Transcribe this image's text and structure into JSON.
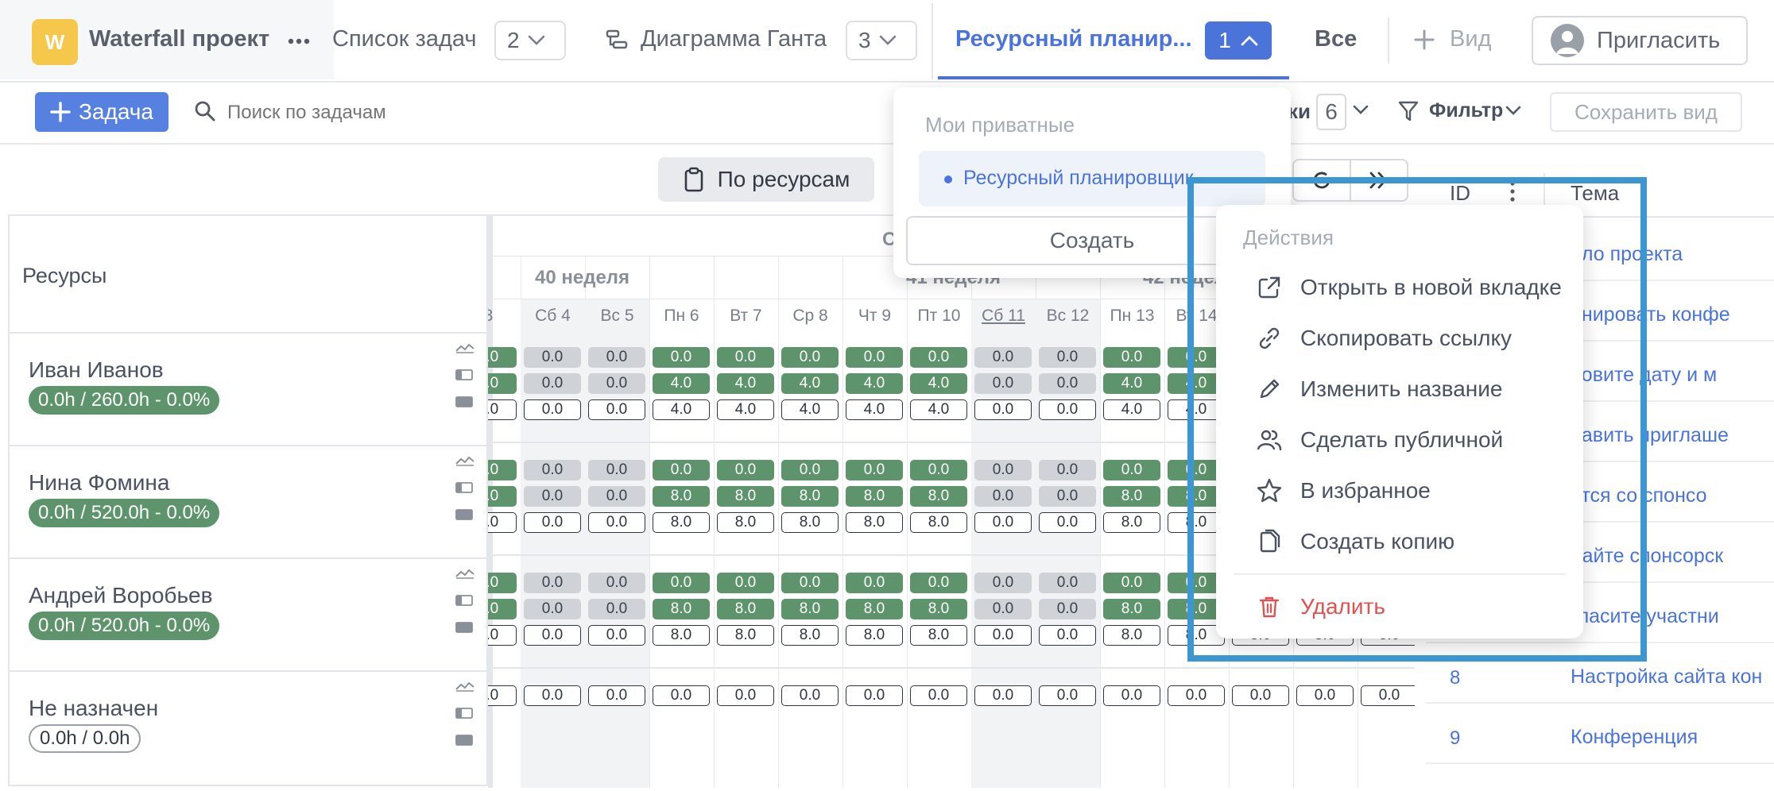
{
  "colors": {
    "accent": "#4a74d9",
    "green": "#5d946b",
    "danger": "#e05252",
    "highlight": "#3b96d2"
  },
  "project": {
    "logo_letter": "W",
    "name": "Waterfall проект"
  },
  "tabs": {
    "task_list": {
      "label": "Список задач",
      "count": "2"
    },
    "gantt": {
      "label": "Диаграмма Ганта",
      "count": "3"
    },
    "resource": {
      "label": "Ресурсный планир...",
      "count": "1"
    },
    "all": {
      "label": "Все"
    },
    "add_view": {
      "label": "Вид"
    },
    "invite": {
      "label": "Пригласить"
    }
  },
  "toolbar": {
    "add_task_label": "Задача",
    "search_placeholder": "Поиск по задачам",
    "columns_label": "ки",
    "columns_count": "6",
    "filter_label": "Фильтр",
    "save_view_label": "Сохранить вид"
  },
  "view": {
    "by_resources_label": "По ресурсам"
  },
  "resources_header": "Ресурсы",
  "weeks": [
    {
      "label": "40 неделя"
    },
    {
      "label": "41 неделя"
    },
    {
      "label": "42 неделя"
    }
  ],
  "month_fragment": "С",
  "days": [
    {
      "label": "3",
      "weekend": false,
      "partial": true
    },
    {
      "label": "Сб 4",
      "weekend": true
    },
    {
      "label": "Вс 5",
      "weekend": true
    },
    {
      "label": "Пн 6",
      "weekend": false
    },
    {
      "label": "Вт 7",
      "weekend": false
    },
    {
      "label": "Ср 8",
      "weekend": false
    },
    {
      "label": "Чт 9",
      "weekend": false
    },
    {
      "label": "Пт 10",
      "weekend": false
    },
    {
      "label": "Сб 11",
      "weekend": true,
      "underlined": true
    },
    {
      "label": "Вс 12",
      "weekend": true
    },
    {
      "label": "Пн 13",
      "weekend": false
    },
    {
      "label": "Вт 14",
      "weekend": false
    },
    {
      "label": "",
      "weekend": false
    },
    {
      "label": "",
      "weekend": false
    },
    {
      "label": "",
      "weekend": false
    }
  ],
  "resources": [
    {
      "name": "Иван Иванов",
      "summary": "0.0h / 260.0h - 0.0%",
      "workday_hours": "4.0",
      "assigned": true
    },
    {
      "name": "Нина Фомина",
      "summary": "0.0h / 520.0h - 0.0%",
      "workday_hours": "8.0",
      "assigned": true
    },
    {
      "name": "Андрей Воробьев",
      "summary": "0.0h / 520.0h - 0.0%",
      "workday_hours": "8.0",
      "assigned": true
    },
    {
      "name": "Не назначен",
      "summary": "0.0h / 0.0h",
      "workday_hours": "0.0",
      "assigned": false
    }
  ],
  "zero_value": "0.0",
  "table": {
    "id_header": "ID",
    "topic_header": "Тема",
    "rows": [
      {
        "id": "",
        "topic": "ало проекта"
      },
      {
        "id": "",
        "topic": "анировать конфе"
      },
      {
        "id": "",
        "topic": "новите дату и м"
      },
      {
        "id": "",
        "topic": "равить приглаше"
      },
      {
        "id": "",
        "topic": "атся со спонсо"
      },
      {
        "id": "",
        "topic": "дайте спонсорск"
      },
      {
        "id": "",
        "topic": "гласите участни"
      },
      {
        "id": "8",
        "topic": "Настройка сайта кон"
      },
      {
        "id": "9",
        "topic": "Конференция"
      }
    ]
  },
  "views_menu": {
    "section_title": "Мои приватные",
    "selected_item": "Ресурсный планировщик",
    "create_label": "Создать"
  },
  "actions_menu": {
    "title": "Действия",
    "items": [
      {
        "label": "Открыть в новой вкладке",
        "icon": "external-link-icon"
      },
      {
        "label": "Скопировать ссылку",
        "icon": "link-icon"
      },
      {
        "label": "Изменить название",
        "icon": "pencil-icon"
      },
      {
        "label": "Сделать публичной",
        "icon": "users-icon"
      },
      {
        "label": "В избранное",
        "icon": "star-icon"
      },
      {
        "label": "Создать копию",
        "icon": "copy-icon"
      }
    ],
    "delete_label": "Удалить"
  }
}
